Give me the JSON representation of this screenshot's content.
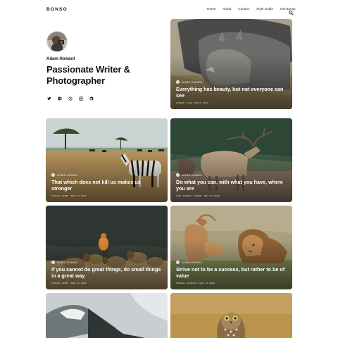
{
  "site": {
    "logo": "BONSO"
  },
  "nav": {
    "items": [
      "Home",
      "About",
      "Contact",
      "Style Guide",
      "Get Bonso"
    ]
  },
  "profile": {
    "name": "Adam Howard",
    "headline": "Passionate Writer & Photographer",
    "socials": [
      "twitter-icon",
      "facebook-icon",
      "dribbble-icon",
      "instagram-icon",
      "github-icon"
    ]
  },
  "posts": [
    {
      "author": "Ahmed Howard",
      "title": "Everything has beauty, but not everyone can see",
      "tags": "Ahmed · Life",
      "date": "Apr 4, 2020"
    },
    {
      "author": "Ahmed Howard",
      "title": "That which does not kill us makes us stronger",
      "tags": "Travel, Ahmt",
      "date": "May 14, 2020"
    },
    {
      "author": "Ahmed Howard",
      "title": "Do what you can, with what you have, where you are",
      "tags": "Life, Travel, Ahmed",
      "date": "May 14, 2020"
    },
    {
      "author": "Ahmed Howard",
      "title": "If you cannot do great things, do small things in a great way",
      "tags": "Travel, Ahmt",
      "date": "May 14, 2020"
    },
    {
      "author": "Ahmed Howard",
      "title": "Strive not to be a success, but rather to be of value",
      "tags": "Travel, Animals",
      "date": "May 14, 2020"
    },
    {
      "author": "",
      "title": "",
      "tags": "",
      "date": ""
    },
    {
      "author": "",
      "title": "",
      "tags": "",
      "date": ""
    }
  ]
}
